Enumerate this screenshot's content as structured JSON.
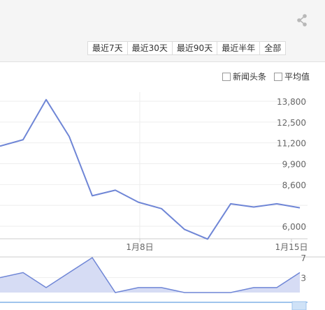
{
  "toolbar": {
    "share_icon": "share-icon",
    "range_buttons": [
      "最近7天",
      "最近30天",
      "最近90天",
      "最近半年",
      "全部"
    ]
  },
  "legend": {
    "news_label": "新闻头条",
    "avg_label": "平均值"
  },
  "colors": {
    "line": "#6f86d6",
    "area_fill": "#d6dcf4",
    "grid": "#eeeeee",
    "band": "#f5f5f5"
  },
  "chart_data": [
    {
      "type": "line",
      "y_ticks": [
        "13,800",
        "12,500",
        "11,200",
        "9,900",
        "8,600",
        "6,000"
      ],
      "x_ticks": [
        "1月8日",
        "1月15日"
      ],
      "points": [
        {
          "x": 0,
          "y": 11000
        },
        {
          "x": 1,
          "y": 11400
        },
        {
          "x": 2,
          "y": 13900
        },
        {
          "x": 3,
          "y": 11600
        },
        {
          "x": 4,
          "y": 7900
        },
        {
          "x": 5,
          "y": 8250
        },
        {
          "x": 6,
          "y": 7500
        },
        {
          "x": 7,
          "y": 7100
        },
        {
          "x": 8,
          "y": 5800
        },
        {
          "x": 9,
          "y": 5200
        },
        {
          "x": 10,
          "y": 7400
        },
        {
          "x": 11,
          "y": 7200
        },
        {
          "x": 12,
          "y": 7400
        },
        {
          "x": 13,
          "y": 7150
        }
      ]
    },
    {
      "type": "area",
      "y_ticks": [
        "7",
        "3"
      ],
      "values": [
        3,
        4,
        1,
        4,
        7,
        0,
        1,
        1,
        0,
        0,
        0,
        1,
        1,
        4
      ]
    }
  ]
}
